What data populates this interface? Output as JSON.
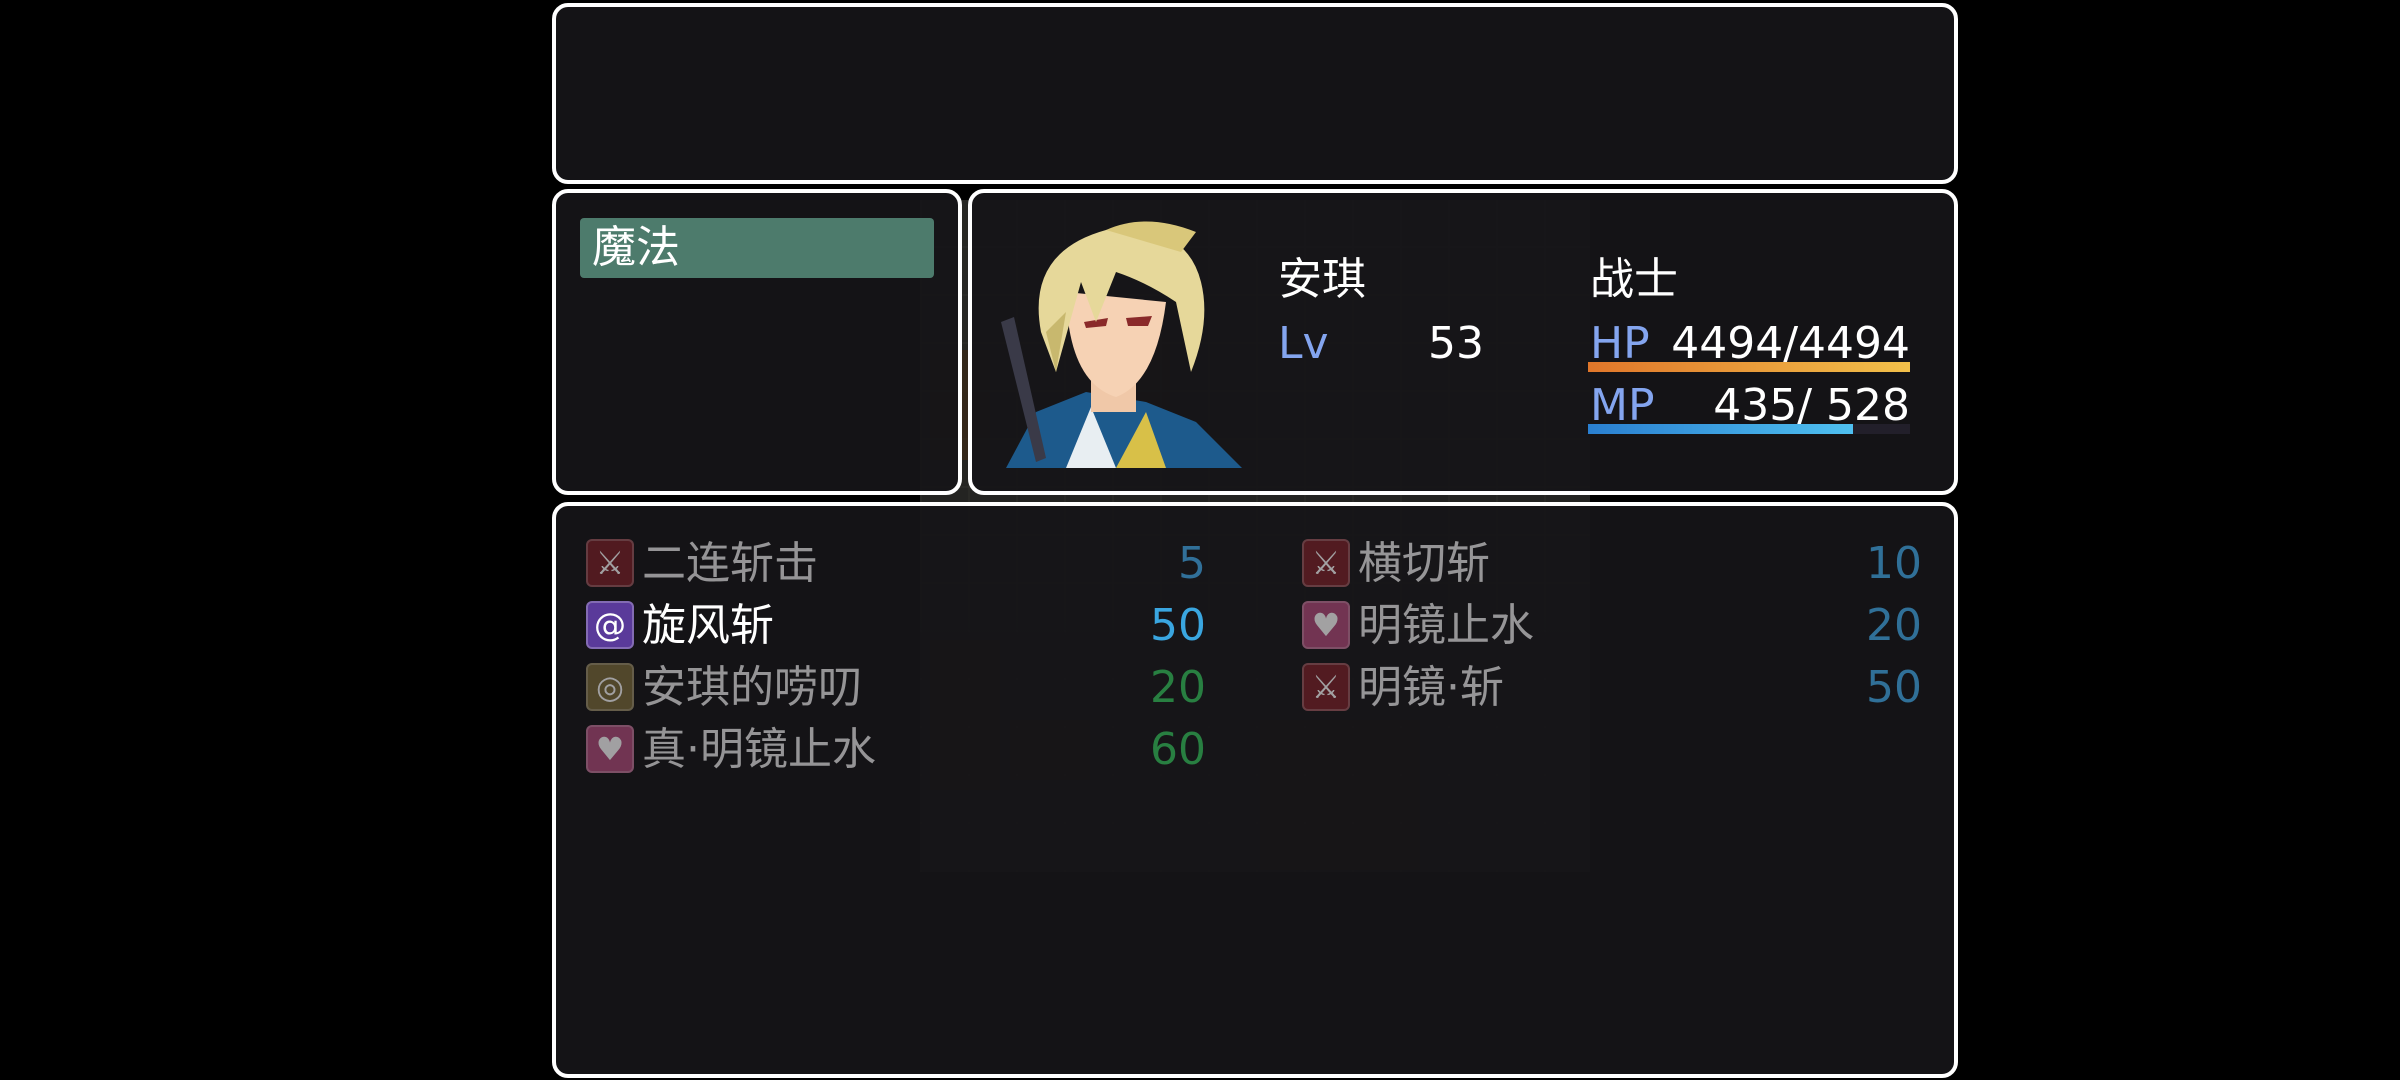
{
  "help": {
    "text": ""
  },
  "command": {
    "selected_label": "魔法"
  },
  "actor": {
    "name": "安琪",
    "class": "战士",
    "level_label": "Lv",
    "level": "53",
    "hp_label": "HP",
    "hp_value": "4494/4494",
    "hp_fraction": 1.0,
    "mp_label": "MP",
    "mp_value": "435/ 528",
    "mp_fraction": 0.824
  },
  "skills": [
    {
      "name": "二连斩击",
      "cost": "5",
      "icon": "sword-slash-icon",
      "enabled": false,
      "cost_color": "#3a8fc4"
    },
    {
      "name": "横切斩",
      "cost": "10",
      "icon": "sword-slash-icon",
      "enabled": false,
      "cost_color": "#3a8fc4"
    },
    {
      "name": "旋风斩",
      "cost": "50",
      "icon": "whirlwind-icon",
      "enabled": true,
      "cost_color": "#3aa6e0"
    },
    {
      "name": "明镜止水",
      "cost": "20",
      "icon": "heart-icon",
      "enabled": false,
      "cost_color": "#3a8fc4"
    },
    {
      "name": "安琪的唠叨",
      "cost": "20",
      "icon": "target-icon",
      "enabled": false,
      "cost_color": "#2ea34f"
    },
    {
      "name": "明镜·斩",
      "cost": "50",
      "icon": "sword-slash-icon",
      "enabled": false,
      "cost_color": "#3a8fc4"
    },
    {
      "name": "真·明镜止水",
      "cost": "60",
      "icon": "heart-icon",
      "enabled": false,
      "cost_color": "#2ea34f"
    }
  ],
  "colors": {
    "hp_gauge": "#e0762a",
    "hp_gauge_end": "#f2c04a",
    "mp_gauge": "#2a7fd0",
    "mp_gauge_end": "#4fc0f0",
    "selection": "#4d7b6c",
    "system_text": "#84a5ef"
  }
}
